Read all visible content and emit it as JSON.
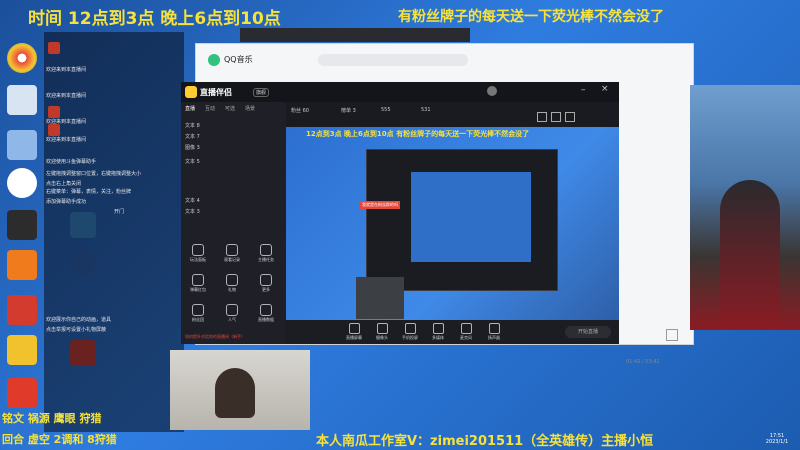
{
  "overlay": {
    "top_left": "时间 12点到3点 晚上6点到10点",
    "top_right": "有粉丝牌子的每天送一下荧光棒不然会没了",
    "bottom_left_1": "铭文 祸源 鹰眼 狩猎",
    "bottom_left_2": "回合 虚空 2调和 8狩猎",
    "bottom_center": "本人南瓜工作室V：zimei201511（全英雄传）主播小恒"
  },
  "desktop": {
    "icons": [
      {
        "name": "chrome-icon",
        "label": "Google Chrome",
        "color": "#e8483c"
      },
      {
        "name": "pc-icon",
        "label": "此电脑",
        "color": "#d9e4f2"
      },
      {
        "name": "network-icon",
        "label": "网络",
        "color": "#8fb8e8"
      },
      {
        "name": "qq-icon",
        "label": "QQ",
        "color": "#e8e8e8"
      },
      {
        "name": "app-icon",
        "label": "",
        "color": "#2c2c2c"
      },
      {
        "name": "orange-app-icon",
        "label": "",
        "color": "#ef7b1d"
      },
      {
        "name": "red-app-icon",
        "label": "",
        "color": "#d23b2d"
      },
      {
        "name": "yellow-app-icon",
        "label": "",
        "color": "#f2c12e"
      },
      {
        "name": "red-square-icon",
        "label": "",
        "color": "#e03a2a"
      }
    ],
    "screen_text": "Sa826"
  },
  "chat": {
    "lines": [
      "欢迎来到本直播间",
      "欢迎来到本直播间",
      "欢迎来到本直播间",
      "欢迎来到本直播间",
      "欢迎使用斗鱼弹幕助手",
      "左键拖拽调整窗口位置，右键拖拽调整大小",
      "点击右上角关闭",
      "右键菜单：弹幕，表情，关注，粉丝牌",
      "添加弹幕助手成功",
      "开门",
      "欢迎展示你自己的动画，道具",
      "点击举报可设置小礼物屏蔽"
    ]
  },
  "qqmusic": {
    "title": "QQ音乐",
    "time": "01:42 / 03:41"
  },
  "studio": {
    "title": "直播伴侣",
    "badge": "旗舰",
    "tabs": [
      "直播",
      "互动",
      "可选",
      "场景"
    ],
    "layers": [
      "文本 8",
      "文本 7",
      "图像 3",
      "文本 5",
      "文本 4",
      "文本 3"
    ],
    "side_buttons": [
      "玩法面板",
      "观看记录",
      "主播任务",
      "弹幕红包",
      "礼物",
      "更多",
      "粉丝团",
      "人气",
      "直播数据"
    ],
    "header_stats": [
      "粉丝 60",
      "榜单 3",
      "555",
      "531"
    ],
    "preview_caption": "12点到3点 晚上6点到10点 有粉丝牌子的每天送一下荧光棒不然会没了",
    "preview_badge": "我就是在粉丝群的吗",
    "bottom_buttons": [
      "直播屏幕",
      "摄像头",
      "手机投屏",
      "多媒体",
      "麦克风",
      "扬声器"
    ],
    "start_button": "开始直播",
    "notice": "如何提升对话你的直播间（新手）"
  },
  "taskbar": {
    "time": "17:51",
    "date": "2023/1/1"
  },
  "colors": {
    "overlay_yellow": "#f6e23a",
    "overlay_green": "#39e06a",
    "studio_dark": "#1a1b21",
    "accent_red": "#e5473b"
  }
}
